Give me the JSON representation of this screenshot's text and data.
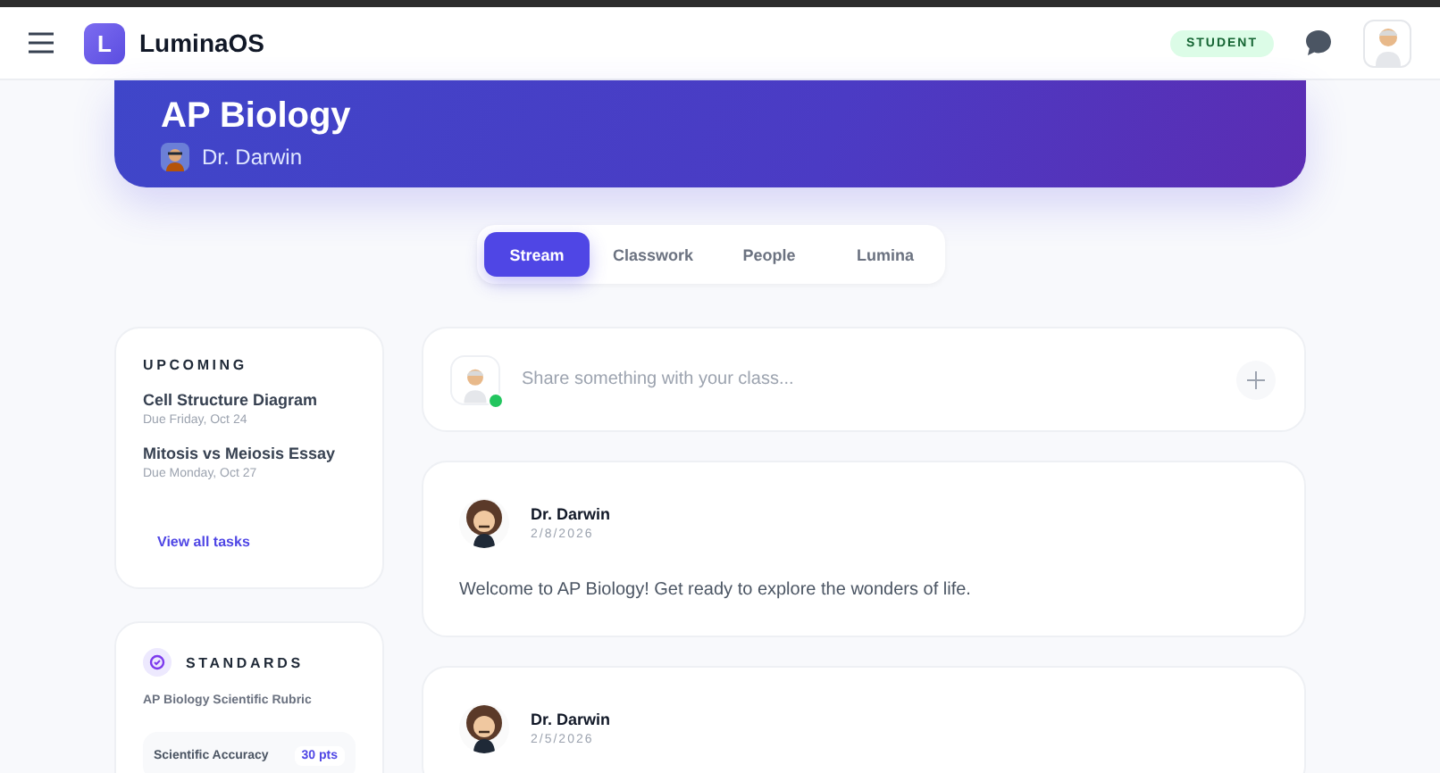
{
  "app": {
    "logo_letter": "L",
    "name": "LuminaOS",
    "role_badge": "STUDENT"
  },
  "course": {
    "title": "AP Biology",
    "teacher": "Dr. Darwin"
  },
  "tabs": [
    {
      "label": "Stream",
      "selected": true
    },
    {
      "label": "Classwork",
      "selected": false
    },
    {
      "label": "People",
      "selected": false
    },
    {
      "label": "Lumina",
      "selected": false
    }
  ],
  "upcoming": {
    "title": "UPCOMING",
    "tasks": [
      {
        "name": "Cell Structure Diagram",
        "due": "Due Friday, Oct 24"
      },
      {
        "name": "Mitosis vs Meiosis Essay",
        "due": "Due Monday, Oct 27"
      }
    ],
    "link": "View all tasks"
  },
  "standards": {
    "title": "STANDARDS",
    "rubric": "AP Biology Scientific Rubric",
    "criteria": [
      {
        "name": "Scientific Accuracy",
        "points": "30 pts"
      }
    ]
  },
  "composer": {
    "placeholder": "Share something with your class...",
    "online": true
  },
  "posts": [
    {
      "author": "Dr. Darwin",
      "date": "2/8/2026",
      "text": "Welcome to AP Biology! Get ready to explore the wonders of life."
    },
    {
      "author": "Dr. Darwin",
      "date": "2/5/2026"
    }
  ]
}
